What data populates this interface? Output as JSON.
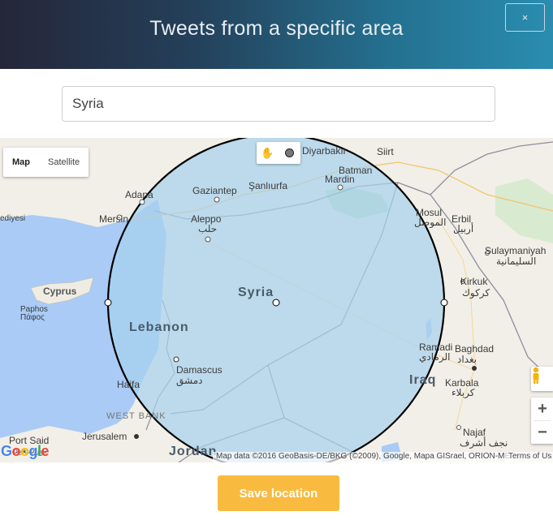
{
  "header": {
    "title": "Tweets from a specific area",
    "close_label": "×"
  },
  "search": {
    "value": "Syria"
  },
  "map": {
    "map_type": [
      "Map",
      "Satellite"
    ],
    "draw_tools": [
      "hand-icon",
      "circle-icon"
    ],
    "zoom_in": "+",
    "zoom_out": "−",
    "google_logo": "Google",
    "attribution": "Map data ©2016 GeoBasis-DE/BKG (©2009), Google, Mapa GISrael, ORION-ME",
    "terms": "Terms of Us",
    "labels": {
      "diyarbakir": "Diyarbakır",
      "siirt": "Siirt",
      "batman": "Batman",
      "mardin": "Mardin",
      "adana": "Adana",
      "gaziantep": "Gaziantep",
      "sanliurfa": "Şanlıurfa",
      "mersin": "Mersin",
      "ediyesi": "ediyesi",
      "aleppo": "Aleppo",
      "aleppo_ar": "حلب",
      "mosul": "Mosul",
      "mosul_ar": "الموصل",
      "erbil": "Erbil",
      "erbil_ar": "أربيل",
      "sulaymaniyah": "Sulaymaniyah",
      "sulaymaniyah_ar": "السليمانية",
      "cyprus": "Cyprus",
      "paphos": "Paphos",
      "paphos_gr": "Πάφος",
      "syria": "Syria",
      "kirkuk": "Kirkuk",
      "kirkuk_ar": "كركوك",
      "lebanon": "Lebanon",
      "ramadi": "Ramadi",
      "ramadi_ar": "الرمادي",
      "baghdad": "Baghdad",
      "baghdad_ar": "بغداد",
      "damascus": "Damascus",
      "damascus_ar": "دمشق",
      "haifa": "Haifa",
      "iraq": "Iraq",
      "karbala": "Karbala",
      "karbala_ar": "كربلاء",
      "west_bank": "WEST BANK",
      "port_said": "Port Said",
      "port_said_ar": "بورسعيد",
      "jerusalem": "Jerusalem",
      "najaf": "Najaf",
      "najaf_ar": "نجف أشرف",
      "jordan": "Jordan"
    },
    "colors": {
      "land": "#f1efe7",
      "sea": "#a9cbf6",
      "circle_fill": "#a6d1ee",
      "circle_stroke": "#000000",
      "park": "#c6e3c2"
    }
  },
  "footer": {
    "save_label": "Save location"
  }
}
